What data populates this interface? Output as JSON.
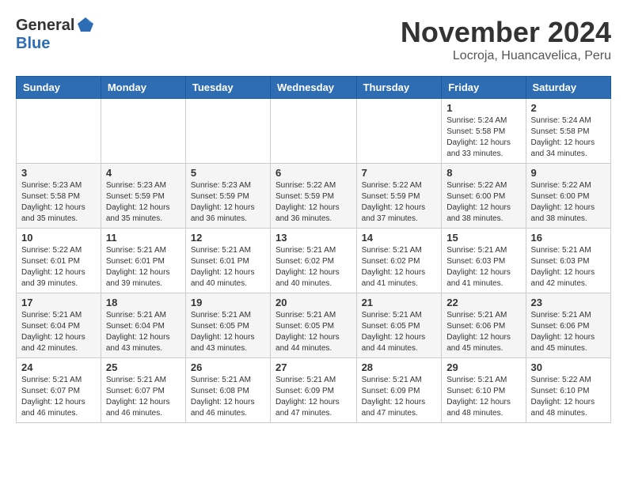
{
  "header": {
    "logo_general": "General",
    "logo_blue": "Blue",
    "month_title": "November 2024",
    "location": "Locroja, Huancavelica, Peru"
  },
  "weekdays": [
    "Sunday",
    "Monday",
    "Tuesday",
    "Wednesday",
    "Thursday",
    "Friday",
    "Saturday"
  ],
  "weeks": [
    [
      {
        "day": "",
        "info": ""
      },
      {
        "day": "",
        "info": ""
      },
      {
        "day": "",
        "info": ""
      },
      {
        "day": "",
        "info": ""
      },
      {
        "day": "",
        "info": ""
      },
      {
        "day": "1",
        "info": "Sunrise: 5:24 AM\nSunset: 5:58 PM\nDaylight: 12 hours\nand 33 minutes."
      },
      {
        "day": "2",
        "info": "Sunrise: 5:24 AM\nSunset: 5:58 PM\nDaylight: 12 hours\nand 34 minutes."
      }
    ],
    [
      {
        "day": "3",
        "info": "Sunrise: 5:23 AM\nSunset: 5:58 PM\nDaylight: 12 hours\nand 35 minutes."
      },
      {
        "day": "4",
        "info": "Sunrise: 5:23 AM\nSunset: 5:59 PM\nDaylight: 12 hours\nand 35 minutes."
      },
      {
        "day": "5",
        "info": "Sunrise: 5:23 AM\nSunset: 5:59 PM\nDaylight: 12 hours\nand 36 minutes."
      },
      {
        "day": "6",
        "info": "Sunrise: 5:22 AM\nSunset: 5:59 PM\nDaylight: 12 hours\nand 36 minutes."
      },
      {
        "day": "7",
        "info": "Sunrise: 5:22 AM\nSunset: 5:59 PM\nDaylight: 12 hours\nand 37 minutes."
      },
      {
        "day": "8",
        "info": "Sunrise: 5:22 AM\nSunset: 6:00 PM\nDaylight: 12 hours\nand 38 minutes."
      },
      {
        "day": "9",
        "info": "Sunrise: 5:22 AM\nSunset: 6:00 PM\nDaylight: 12 hours\nand 38 minutes."
      }
    ],
    [
      {
        "day": "10",
        "info": "Sunrise: 5:22 AM\nSunset: 6:01 PM\nDaylight: 12 hours\nand 39 minutes."
      },
      {
        "day": "11",
        "info": "Sunrise: 5:21 AM\nSunset: 6:01 PM\nDaylight: 12 hours\nand 39 minutes."
      },
      {
        "day": "12",
        "info": "Sunrise: 5:21 AM\nSunset: 6:01 PM\nDaylight: 12 hours\nand 40 minutes."
      },
      {
        "day": "13",
        "info": "Sunrise: 5:21 AM\nSunset: 6:02 PM\nDaylight: 12 hours\nand 40 minutes."
      },
      {
        "day": "14",
        "info": "Sunrise: 5:21 AM\nSunset: 6:02 PM\nDaylight: 12 hours\nand 41 minutes."
      },
      {
        "day": "15",
        "info": "Sunrise: 5:21 AM\nSunset: 6:03 PM\nDaylight: 12 hours\nand 41 minutes."
      },
      {
        "day": "16",
        "info": "Sunrise: 5:21 AM\nSunset: 6:03 PM\nDaylight: 12 hours\nand 42 minutes."
      }
    ],
    [
      {
        "day": "17",
        "info": "Sunrise: 5:21 AM\nSunset: 6:04 PM\nDaylight: 12 hours\nand 42 minutes."
      },
      {
        "day": "18",
        "info": "Sunrise: 5:21 AM\nSunset: 6:04 PM\nDaylight: 12 hours\nand 43 minutes."
      },
      {
        "day": "19",
        "info": "Sunrise: 5:21 AM\nSunset: 6:05 PM\nDaylight: 12 hours\nand 43 minutes."
      },
      {
        "day": "20",
        "info": "Sunrise: 5:21 AM\nSunset: 6:05 PM\nDaylight: 12 hours\nand 44 minutes."
      },
      {
        "day": "21",
        "info": "Sunrise: 5:21 AM\nSunset: 6:05 PM\nDaylight: 12 hours\nand 44 minutes."
      },
      {
        "day": "22",
        "info": "Sunrise: 5:21 AM\nSunset: 6:06 PM\nDaylight: 12 hours\nand 45 minutes."
      },
      {
        "day": "23",
        "info": "Sunrise: 5:21 AM\nSunset: 6:06 PM\nDaylight: 12 hours\nand 45 minutes."
      }
    ],
    [
      {
        "day": "24",
        "info": "Sunrise: 5:21 AM\nSunset: 6:07 PM\nDaylight: 12 hours\nand 46 minutes."
      },
      {
        "day": "25",
        "info": "Sunrise: 5:21 AM\nSunset: 6:07 PM\nDaylight: 12 hours\nand 46 minutes."
      },
      {
        "day": "26",
        "info": "Sunrise: 5:21 AM\nSunset: 6:08 PM\nDaylight: 12 hours\nand 46 minutes."
      },
      {
        "day": "27",
        "info": "Sunrise: 5:21 AM\nSunset: 6:09 PM\nDaylight: 12 hours\nand 47 minutes."
      },
      {
        "day": "28",
        "info": "Sunrise: 5:21 AM\nSunset: 6:09 PM\nDaylight: 12 hours\nand 47 minutes."
      },
      {
        "day": "29",
        "info": "Sunrise: 5:21 AM\nSunset: 6:10 PM\nDaylight: 12 hours\nand 48 minutes."
      },
      {
        "day": "30",
        "info": "Sunrise: 5:22 AM\nSunset: 6:10 PM\nDaylight: 12 hours\nand 48 minutes."
      }
    ]
  ]
}
